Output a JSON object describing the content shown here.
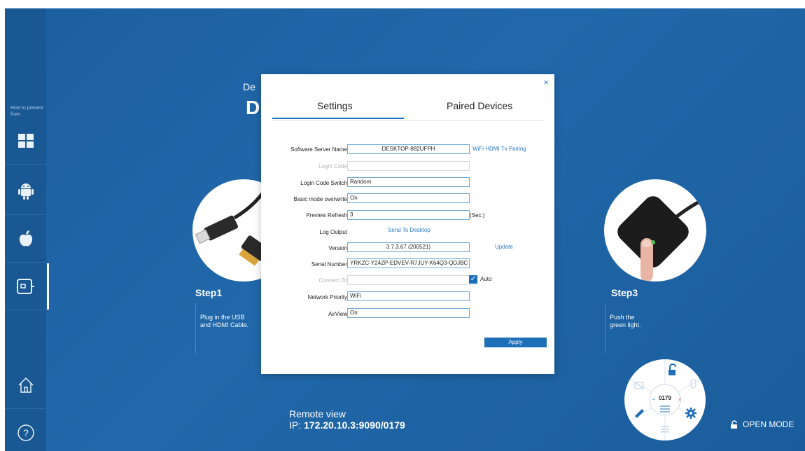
{
  "sidebar": {
    "label": "How to present from",
    "items": [
      {
        "name": "windows",
        "icon": "windows-icon"
      },
      {
        "name": "android",
        "icon": "android-icon"
      },
      {
        "name": "apple",
        "icon": "apple-icon"
      },
      {
        "name": "device",
        "icon": "hdmi-device-icon",
        "active": true
      },
      {
        "name": "home",
        "icon": "home-icon"
      },
      {
        "name": "help",
        "icon": "help-icon"
      }
    ]
  },
  "page": {
    "header_small": "De",
    "header_big": "D",
    "step1": {
      "title": "Step1",
      "text_line1": "Plug in the USB",
      "text_line2": "and HDMI Cable."
    },
    "step3": {
      "title": "Step3",
      "text_line1": "Push the",
      "text_line2": "green light."
    },
    "remote": {
      "label": "Remote view",
      "ip_prefix": "IP:",
      "ip": "172.20.10.3:9090/0179"
    },
    "wheel": {
      "code": "0179"
    },
    "open_mode": "OPEN MODE"
  },
  "dialog": {
    "tabs": [
      "Settings",
      "Paired Devices"
    ],
    "rows": {
      "server_name": {
        "label": "Software Server Name",
        "value": "DESKTOP-882UFPH",
        "link": "WiFi HDMI Tx Pairing"
      },
      "login_code": {
        "label": "Login Code",
        "value": ""
      },
      "login_switch": {
        "label": "Login Code Switch",
        "value": "Random"
      },
      "basic_mode": {
        "label": "Basic mode overwrite",
        "value": "On"
      },
      "preview_refresh": {
        "label": "Preview Refresh",
        "value": "3",
        "unit": "(Sec.)"
      },
      "log_output": {
        "label": "Log Output",
        "link": "Send To Desktop"
      },
      "version": {
        "label": "Version",
        "value": "3.7.3.67 (200521)",
        "link": "Update"
      },
      "serial": {
        "label": "Serial Number",
        "value": "YRKZC-Y24ZP-EDVEV-R7JUY-K64Q3-QDJBC"
      },
      "connect_to": {
        "label": "Connect To",
        "value": "",
        "checkbox_label": "Auto"
      },
      "network": {
        "label": "Network Priority",
        "value": "WiFi"
      },
      "airview": {
        "label": "AirView",
        "value": "On"
      }
    },
    "apply": "Apply",
    "close": "×"
  },
  "colors": {
    "background": "#1e62a4",
    "sidebar": "#1a5894",
    "accent": "#1d6fb8"
  }
}
